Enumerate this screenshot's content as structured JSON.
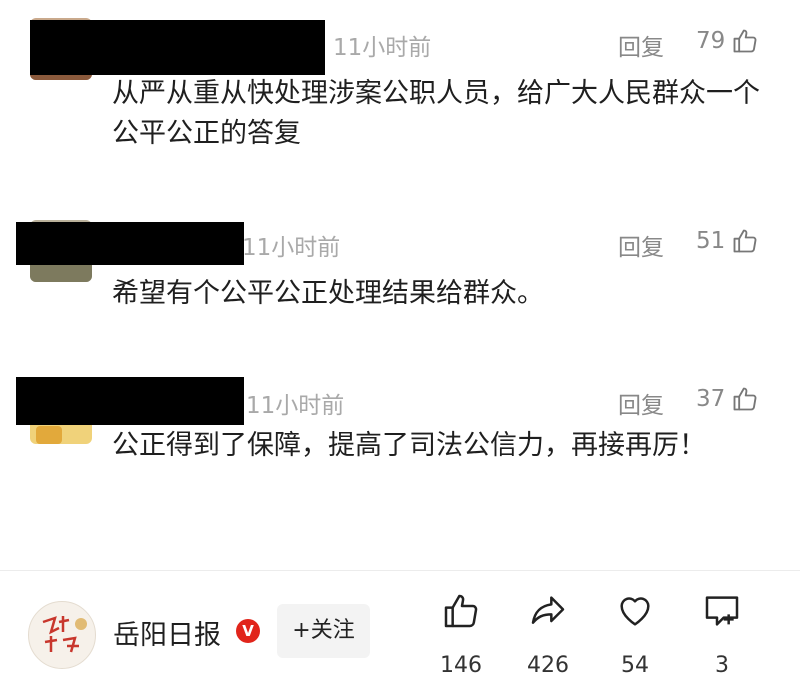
{
  "comments": [
    {
      "time": "11小时前",
      "reply_label": "回复",
      "likes": "79",
      "text": "从严从重从快处理涉案公职人员，给广大人民群众一个公平公正的答复"
    },
    {
      "time": "11小时前",
      "reply_label": "回复",
      "likes": "51",
      "text": "希望有个公平公正处理结果给群众。"
    },
    {
      "time": "11小时前",
      "reply_label": "回复",
      "likes": "37",
      "text": "公正得到了保障，提高了司法公信力，再接再厉！"
    }
  ],
  "footer": {
    "account_name": "岳阳日报",
    "verified_badge": "V",
    "follow_label": "+关注",
    "actions": {
      "like_count": "146",
      "share_count": "426",
      "favorite_count": "54",
      "comment_count": "3"
    },
    "icons": [
      "thumbs-up-icon",
      "share-icon",
      "heart-icon",
      "comment-plus-icon"
    ]
  },
  "colors": {
    "verified_red": "#e1251b",
    "meta_gray": "#a9a9a9",
    "redaction": "#000000"
  }
}
